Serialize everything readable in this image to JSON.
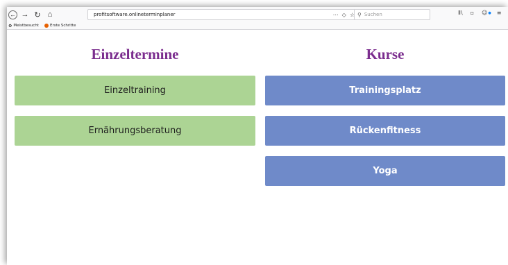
{
  "browser": {
    "url": "profitsoftware.onlineterminplaner",
    "search_placeholder": "Suchen",
    "nav": {
      "back_icon": "back-arrow-icon",
      "forward_icon": "forward-arrow-icon",
      "reload_icon": "reload-icon",
      "home_icon": "home-icon"
    },
    "url_icons": {
      "more": "⋯",
      "pocket": "◇",
      "star": "☆"
    },
    "right_icons": {
      "library": "Ⅱ\\",
      "sidebar": "▫",
      "account": "☺",
      "menu": "≡"
    }
  },
  "bookmarks": [
    {
      "label": "Meistbesucht",
      "icon": "gear-icon"
    },
    {
      "label": "Erste Schritte",
      "icon": "firefox-icon"
    }
  ],
  "page": {
    "einzeltermine": {
      "title": "Einzeltermine",
      "items": [
        "Einzeltraining",
        "Ernährungsberatung"
      ],
      "color": "#acd494"
    },
    "kurse": {
      "title": "Kurse",
      "items": [
        "Trainingsplatz",
        "Rückenfitness",
        "Yoga"
      ],
      "color": "#6f8ac9"
    },
    "title_color": "#7b2d8e"
  }
}
